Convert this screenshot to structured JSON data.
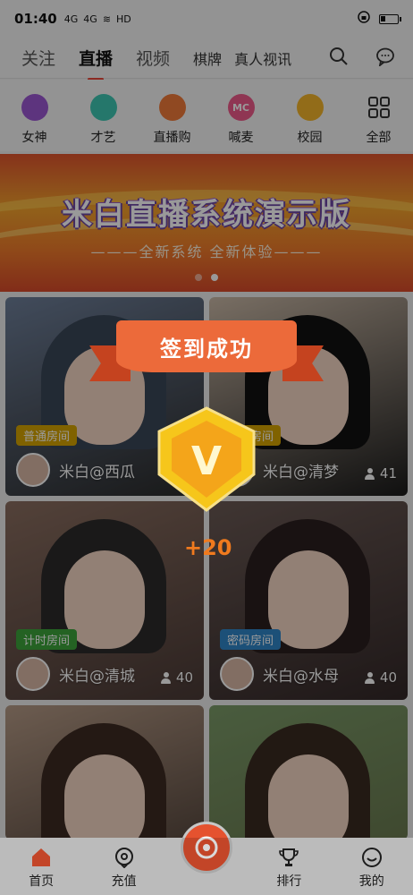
{
  "status_bar": {
    "time": "01:40",
    "signal_1": "4G",
    "signal_2": "4G",
    "hd": "HD",
    "battery_level": 0.3
  },
  "top_nav": {
    "tabs": [
      {
        "label": "关注"
      },
      {
        "label": "直播",
        "active": true
      },
      {
        "label": "视频"
      },
      {
        "label": "棋牌"
      },
      {
        "label": "真人视讯"
      }
    ],
    "icons": [
      "search-icon",
      "message-icon"
    ]
  },
  "categories": [
    {
      "label": "女神",
      "icon": "high-heel-icon",
      "color": "#9b57d3",
      "icon_text": ""
    },
    {
      "label": "才艺",
      "icon": "palette-icon",
      "color": "#3fc7b2",
      "icon_text": ""
    },
    {
      "label": "直播购",
      "icon": "shopping-bag-icon",
      "color": "#f07a3a",
      "icon_text": ""
    },
    {
      "label": "喊麦",
      "icon": "mc-icon",
      "color": "#ef5a8a",
      "icon_text": "MC"
    },
    {
      "label": "校园",
      "icon": "graduation-cap-icon",
      "color": "#f4b52b",
      "icon_text": ""
    },
    {
      "label": "全部",
      "icon": "grid-icon",
      "color": "#333333",
      "icon_text": ""
    }
  ],
  "banner": {
    "title": "米白直播系统演示版",
    "subtitle": "———全新系统 全新体验———",
    "dots": 2,
    "active_dot": 1
  },
  "streams": [
    {
      "room_type": "普通房间",
      "room_color": "#d6a400",
      "name": "米白@西瓜",
      "viewers": ""
    },
    {
      "room_type": "普通房间",
      "room_color": "#d6a400",
      "name": "米白@清梦",
      "viewers": "41"
    },
    {
      "room_type": "计时房间",
      "room_color": "#3da33b",
      "name": "米白@清城",
      "viewers": "40"
    },
    {
      "room_type": "密码房间",
      "room_color": "#2f86c9",
      "name": "米白@水母",
      "viewers": "40"
    }
  ],
  "popup": {
    "title": "签到成功",
    "points": "+20",
    "badge_letter": "V"
  },
  "bottom_nav": [
    {
      "label": "首页",
      "icon": "home-icon"
    },
    {
      "label": "充值",
      "icon": "recharge-icon"
    },
    {
      "label": "",
      "icon": "camera-icon"
    },
    {
      "label": "排行",
      "icon": "trophy-icon"
    },
    {
      "label": "我的",
      "icon": "profile-icon"
    }
  ]
}
